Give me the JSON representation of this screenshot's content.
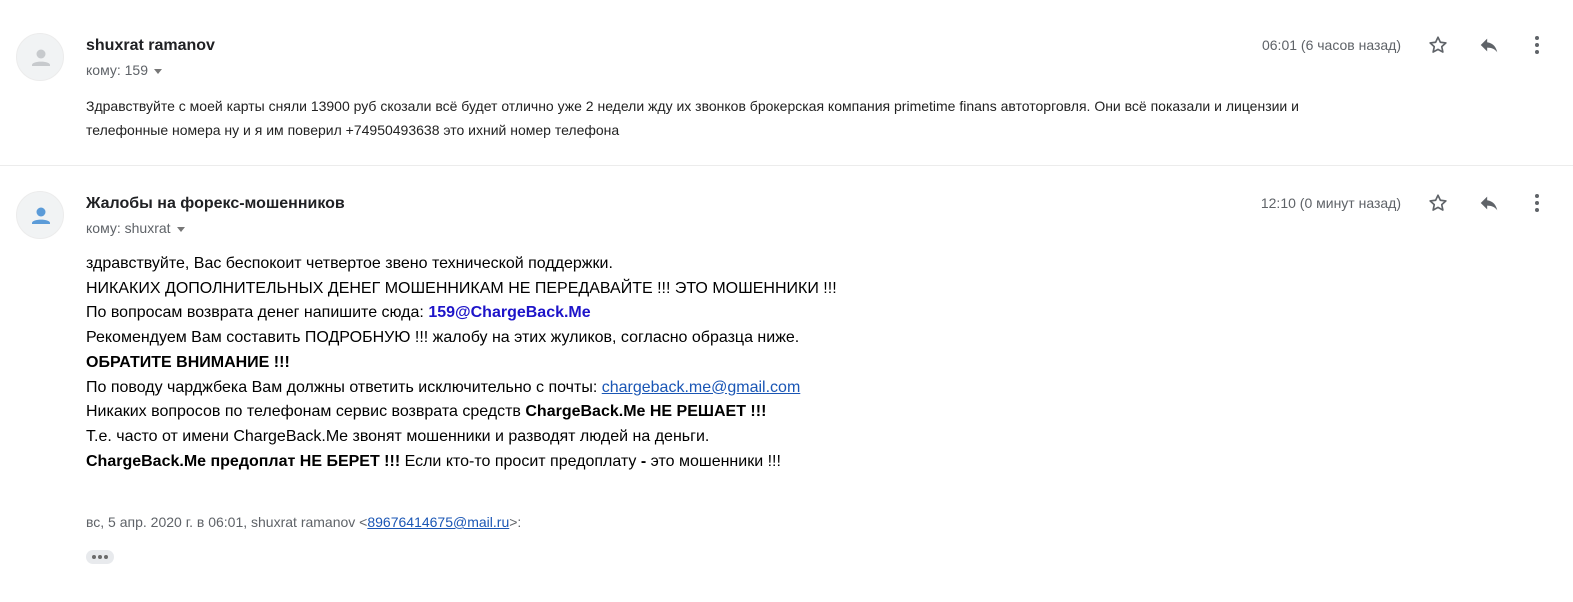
{
  "messages": [
    {
      "sender": "shuxrat ramanov",
      "to": "кому: 159",
      "time": "06:01 (6 часов назад)",
      "body_lines": [
        "Здравствуйте с моей карты сняли 13900 руб скозали всё будет отлично уже 2 недели жду их звонков брокерская компания primetime finans автоторговля. Они всё показали и лицензии и",
        "телефонные номера ну и я им поверил +74950493638 это ихний номер телефона"
      ]
    },
    {
      "sender": "Жалобы на форекс-мошенников",
      "to": "кому: shuxrat",
      "time": "12:10 (0 минут назад)",
      "line1": "здравствуйте, Вас беспокоит четвертое звено технической поддержки.",
      "line2": "НИКАКИХ ДОПОЛНИТЕЛЬНЫХ ДЕНЕГ МОШЕННИКАМ НЕ ПЕРЕДАВАЙТЕ !!! ЭТО МОШЕННИКИ !!!",
      "line3_prefix": "По вопросам возврата денег напишите сюда: ",
      "line3_email": "159@ChargeBack.Me",
      "line4": "Рекомендуем Вам составить ПОДРОБНУЮ !!! жалобу на этих жуликов, согласно образца ниже.",
      "line5": "ОБРАТИТЕ ВНИМАНИЕ !!!",
      "line6_prefix": "По поводу чарджбека Вам должны ответить исключительно с почты: ",
      "line6_email": "chargeback.me@gmail.com",
      "line7_prefix": "Никаких вопросов по телефонам сервис возврата средств ",
      "line7_bold": "ChargeBack.Me НЕ РЕШАЕТ !!!",
      "line8": "Т.е. часто от имени ChargeBack.Me звонят мошенники и разводят людей на деньги.",
      "line9_bold1": "ChargeBack.Me предоплат НЕ БЕРЕТ !!!",
      "line9_mid": " Если кто-то просит предоплату ",
      "line9_bold2": "-",
      "line9_end": " это мошенники !!!",
      "quote_prefix": "вс, 5 апр. 2020 г. в 06:01, shuxrat ramanov <",
      "quote_email": "89676414675@mail.ru",
      "quote_suffix": ">:"
    }
  ],
  "icons": [
    "avatar-person-icon",
    "star-icon",
    "reply-icon",
    "more-vert-icon",
    "show-trimmed-content-icon"
  ]
}
